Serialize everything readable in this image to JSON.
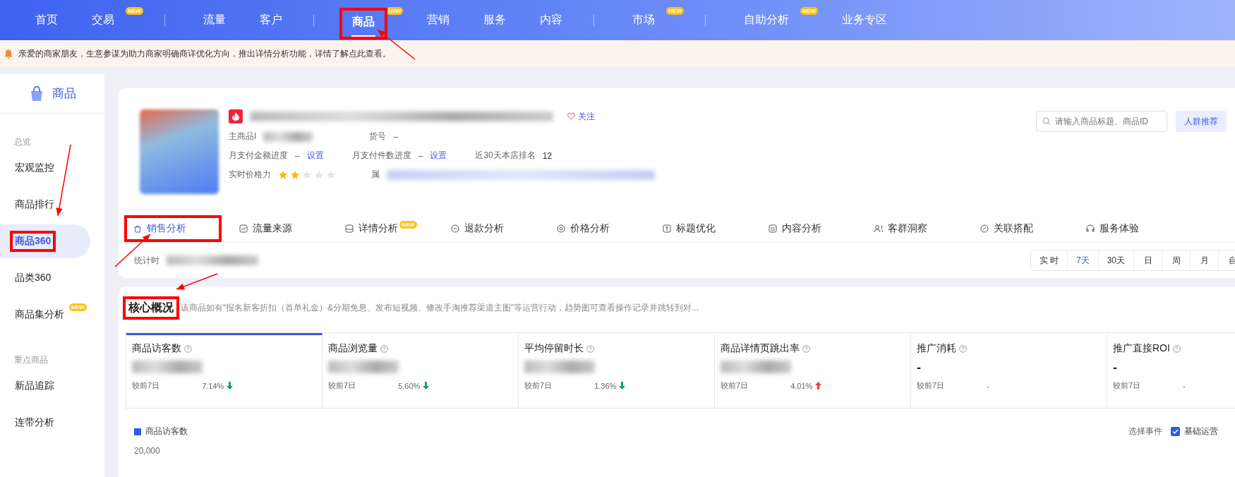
{
  "top_nav": {
    "groups": [
      {
        "items": [
          {
            "label": "首页",
            "selected": false,
            "marked": false
          },
          {
            "label": "交易",
            "badge": "NEW",
            "selected": false,
            "marked": false
          }
        ]
      },
      {
        "items": [
          {
            "label": "流量",
            "selected": false,
            "marked": false
          },
          {
            "label": "客户",
            "selected": false,
            "marked": false
          }
        ]
      },
      {
        "items": [
          {
            "label": "商品",
            "badge": "NEW",
            "selected": true,
            "marked": true
          },
          {
            "label": "营销",
            "selected": false,
            "marked": false
          },
          {
            "label": "服务",
            "selected": false,
            "marked": false
          },
          {
            "label": "内容",
            "selected": false,
            "marked": false
          }
        ]
      },
      {
        "items": [
          {
            "label": "市场",
            "badge": "NEW",
            "selected": false,
            "marked": false
          }
        ]
      },
      {
        "items": [
          {
            "label": "自助分析",
            "badge": "NEW",
            "selected": false,
            "marked": false
          },
          {
            "label": "业务专区",
            "selected": false,
            "marked": false
          }
        ]
      }
    ]
  },
  "notice": "亲爱的商家朋友，生意参谋为助力商家明确商详优化方向，推出详情分析功能，详情了解点此查看。",
  "sidebar": {
    "title": "商品",
    "groups": [
      {
        "heading": "总览",
        "items": [
          {
            "label": "宏观监控",
            "selected": false,
            "marked": false
          },
          {
            "label": "商品排行",
            "selected": false,
            "marked": false
          },
          {
            "label": "商品360",
            "selected": true,
            "marked": true
          },
          {
            "label": "品类360",
            "selected": false,
            "marked": false
          },
          {
            "label": "商品集分析",
            "badge": "NEW",
            "selected": false,
            "marked": false
          }
        ]
      },
      {
        "heading": "重点商品",
        "items": [
          {
            "label": "新品追踪",
            "selected": false,
            "marked": false
          },
          {
            "label": "连带分析",
            "selected": false,
            "marked": false
          }
        ]
      }
    ]
  },
  "product": {
    "follow": "关注",
    "id_label": "主商品I",
    "sku_label": "货号",
    "sku_value": "–",
    "progress": [
      {
        "label": "月支付金额进度",
        "value": "–",
        "link": "设置"
      },
      {
        "label": "月支付件数进度",
        "value": "–",
        "link": "设置"
      }
    ],
    "rank_label": "近30天本店排名",
    "rank_value": "12",
    "price_label": "实时价格力",
    "stars": 2,
    "attr_label": "属",
    "search": {
      "placeholder": "请输入商品标题、商品ID"
    },
    "button": "人群推荐"
  },
  "tabs": [
    {
      "label": "销售分析",
      "selected": true,
      "marked": true
    },
    {
      "label": "流量来源",
      "selected": false,
      "marked": false
    },
    {
      "label": "详情分析",
      "badge": "NEW",
      "selected": false,
      "marked": false
    },
    {
      "label": "退款分析",
      "selected": false,
      "marked": false
    },
    {
      "label": "价格分析",
      "selected": false,
      "marked": false
    },
    {
      "label": "标题优化",
      "selected": false,
      "marked": false
    },
    {
      "label": "内容分析",
      "selected": false,
      "marked": false
    },
    {
      "label": "客群洞察",
      "selected": false,
      "marked": false
    },
    {
      "label": "关联搭配",
      "selected": false,
      "marked": false
    },
    {
      "label": "服务体验",
      "selected": false,
      "marked": false
    }
  ],
  "stat_label": "统计时",
  "periods": [
    {
      "label": "实 时",
      "selected": false
    },
    {
      "label": "7天",
      "selected": true
    },
    {
      "label": "30天",
      "selected": false
    },
    {
      "label": "日",
      "selected": false
    },
    {
      "label": "周",
      "selected": false
    },
    {
      "label": "月",
      "selected": false
    },
    {
      "label": "自",
      "selected": false
    }
  ],
  "overview": {
    "title": "核心概况",
    "marked": true,
    "description": "该商品如有“报名新客折扣（首单礼金）&分期免息、发布短视频、修改手淘推荐渠道主图”等运营行动，趋势图可查看操作记录并跳转到对...",
    "metrics": [
      {
        "label": "商品访客数",
        "compare": "较前7日",
        "change": "7.14%",
        "rising": false,
        "selected": true
      },
      {
        "label": "商品浏览量",
        "compare": "较前7日",
        "change": "5.60%",
        "rising": false,
        "selected": false
      },
      {
        "label": "平均停留时长",
        "compare": "较前7日",
        "change": "1.36%",
        "rising": false,
        "selected": false
      },
      {
        "label": "商品详情页跳出率",
        "compare": "较前7日",
        "change": "4.01%",
        "rising": true,
        "selected": false
      },
      {
        "label": "推广消耗",
        "value": "-",
        "compare": "较前7日",
        "change": "-",
        "selected": false
      },
      {
        "label": "推广直接ROI",
        "value": "-",
        "compare": "较前7日",
        "change": "-",
        "selected": false
      }
    ],
    "legend": "商品访客数",
    "axis_label": "20,000",
    "event_label": "选择事件",
    "event_checkbox": {
      "label": "基础运营",
      "checked": true
    }
  }
}
